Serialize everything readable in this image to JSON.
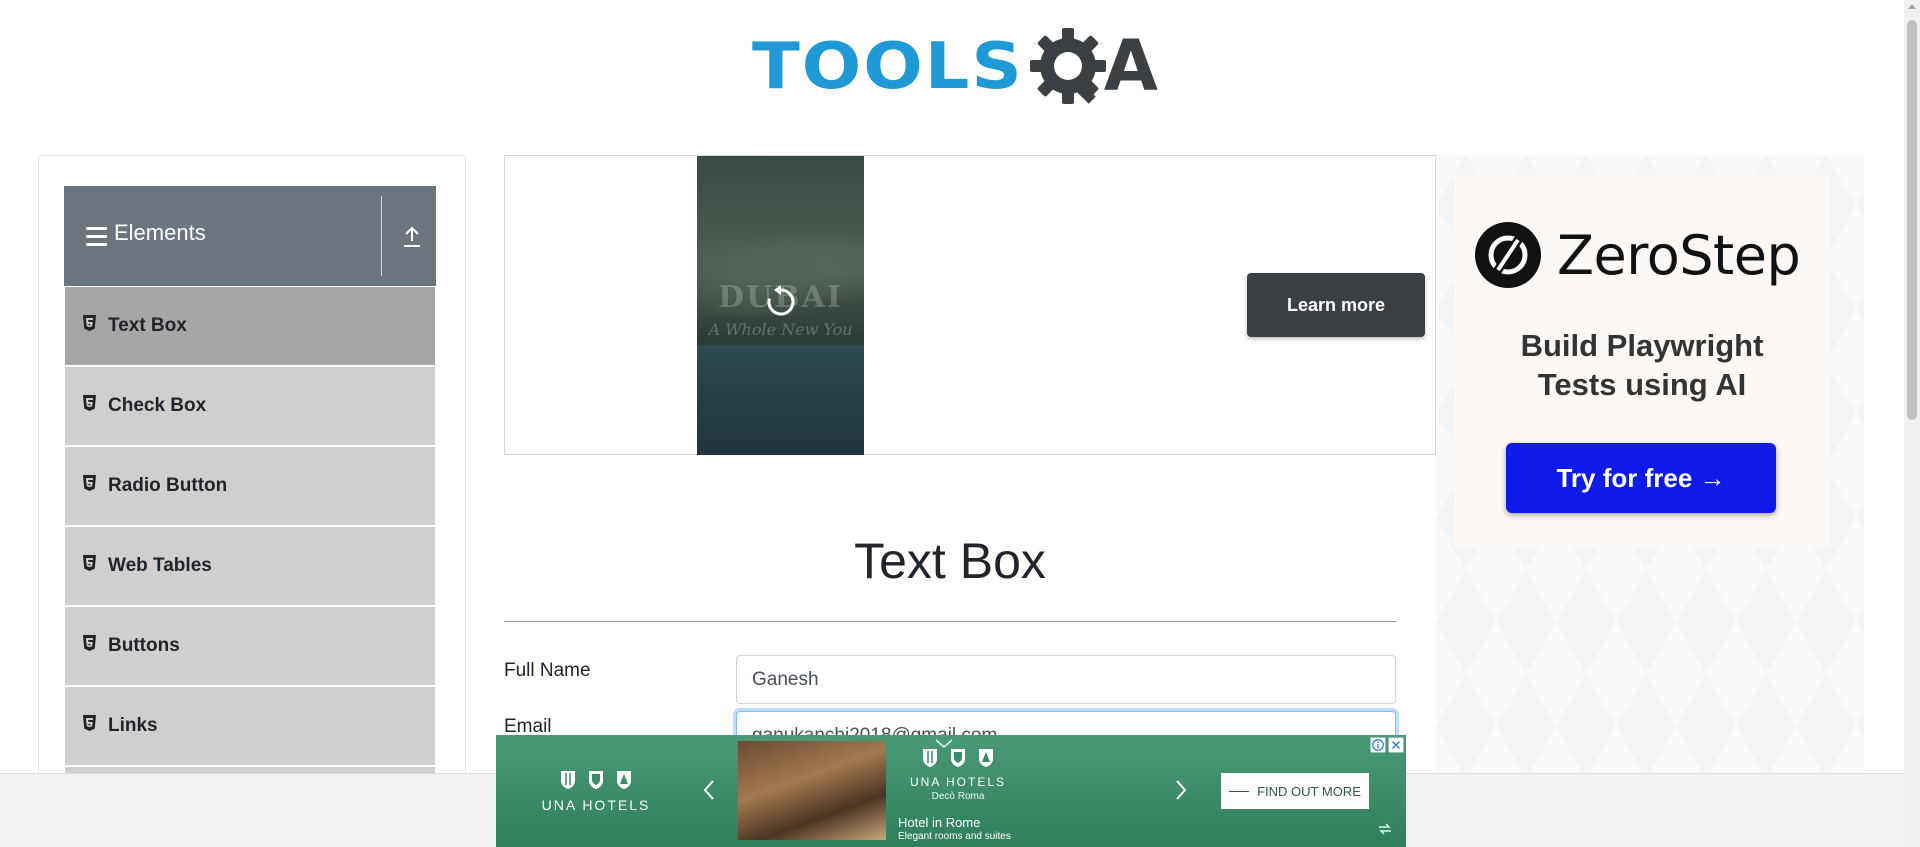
{
  "header": {
    "logo_text_left": "TOOLS",
    "logo_text_right": "A"
  },
  "sidebar": {
    "group_title": "Elements",
    "items": [
      {
        "label": "Text Box",
        "active": true
      },
      {
        "label": "Check Box",
        "active": false
      },
      {
        "label": "Radio Button",
        "active": false
      },
      {
        "label": "Web Tables",
        "active": false
      },
      {
        "label": "Buttons",
        "active": false
      },
      {
        "label": "Links",
        "active": false
      }
    ]
  },
  "banner_ad": {
    "video_title": "DUBAI",
    "video_tagline": "A Whole New You",
    "button_label": "Learn more"
  },
  "right_ad": {
    "brand": "ZeroStep",
    "tagline_line1": "Build Playwright",
    "tagline_line2": "Tests using AI",
    "button_label": "Try for free →",
    "button_color": "#0d1ae8"
  },
  "main": {
    "title": "Text Box",
    "fields": [
      {
        "label": "Full Name",
        "value": "Ganesh"
      },
      {
        "label": "Email",
        "value": "ganukanchi2018@gmail.com"
      }
    ]
  },
  "bottom_ad": {
    "brand": "UNA HOTELS",
    "sub_brand": "Decò Roma",
    "headline": "Hotel in Rome",
    "subline": "Elegant rooms and suites",
    "cta_label": "FIND OUT MORE",
    "bg_color": "#3a8c6a"
  },
  "colors": {
    "accent_blue": "#1f9ad6",
    "sidebar_header": "#6c757d",
    "sidebar_item": "#cfcfcf",
    "sidebar_item_active": "#a6a6a6"
  }
}
